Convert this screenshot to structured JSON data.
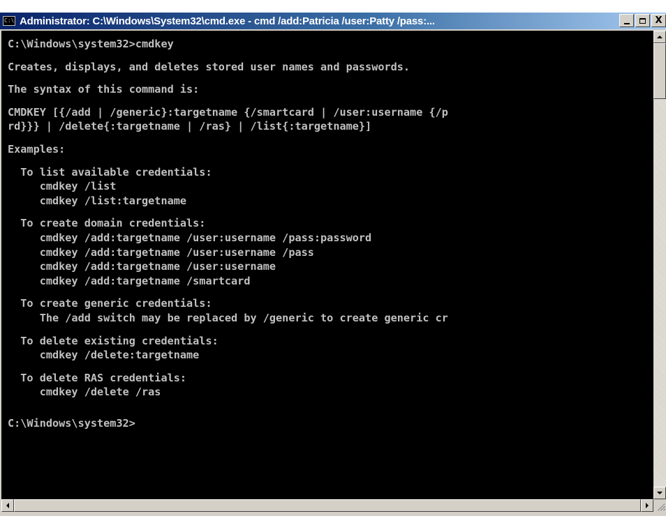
{
  "window": {
    "title": "Administrator: C:\\Windows\\System32\\cmd.exe - cmd  /add:Patricia /user:Patty /pass:...",
    "icon_label": "C:\\",
    "controls": {
      "minimize_icon": "minimize-icon",
      "maximize_icon": "maximize-icon",
      "close_label": "X"
    }
  },
  "console": {
    "background": "#000000",
    "foreground": "#c0c0c0",
    "lines": [
      "C:\\Windows\\system32>cmdkey",
      "",
      "Creates, displays, and deletes stored user names and passwords.",
      "",
      "The syntax of this command is:",
      "",
      "CMDKEY [{/add | /generic}:targetname {/smartcard | /user:username {/p",
      "rd}}} | /delete{:targetname | /ras} | /list{:targetname}]",
      "",
      "Examples:",
      "",
      "  To list available credentials:",
      "     cmdkey /list",
      "     cmdkey /list:targetname",
      "",
      "  To create domain credentials:",
      "     cmdkey /add:targetname /user:username /pass:password",
      "     cmdkey /add:targetname /user:username /pass",
      "     cmdkey /add:targetname /user:username",
      "     cmdkey /add:targetname /smartcard",
      "",
      "  To create generic credentials:",
      "     The /add switch may be replaced by /generic to create generic cr",
      "",
      "  To delete existing credentials:",
      "     cmdkey /delete:targetname",
      "",
      "  To delete RAS credentials:",
      "     cmdkey /delete /ras",
      "",
      "",
      "C:\\Windows\\system32>"
    ]
  }
}
